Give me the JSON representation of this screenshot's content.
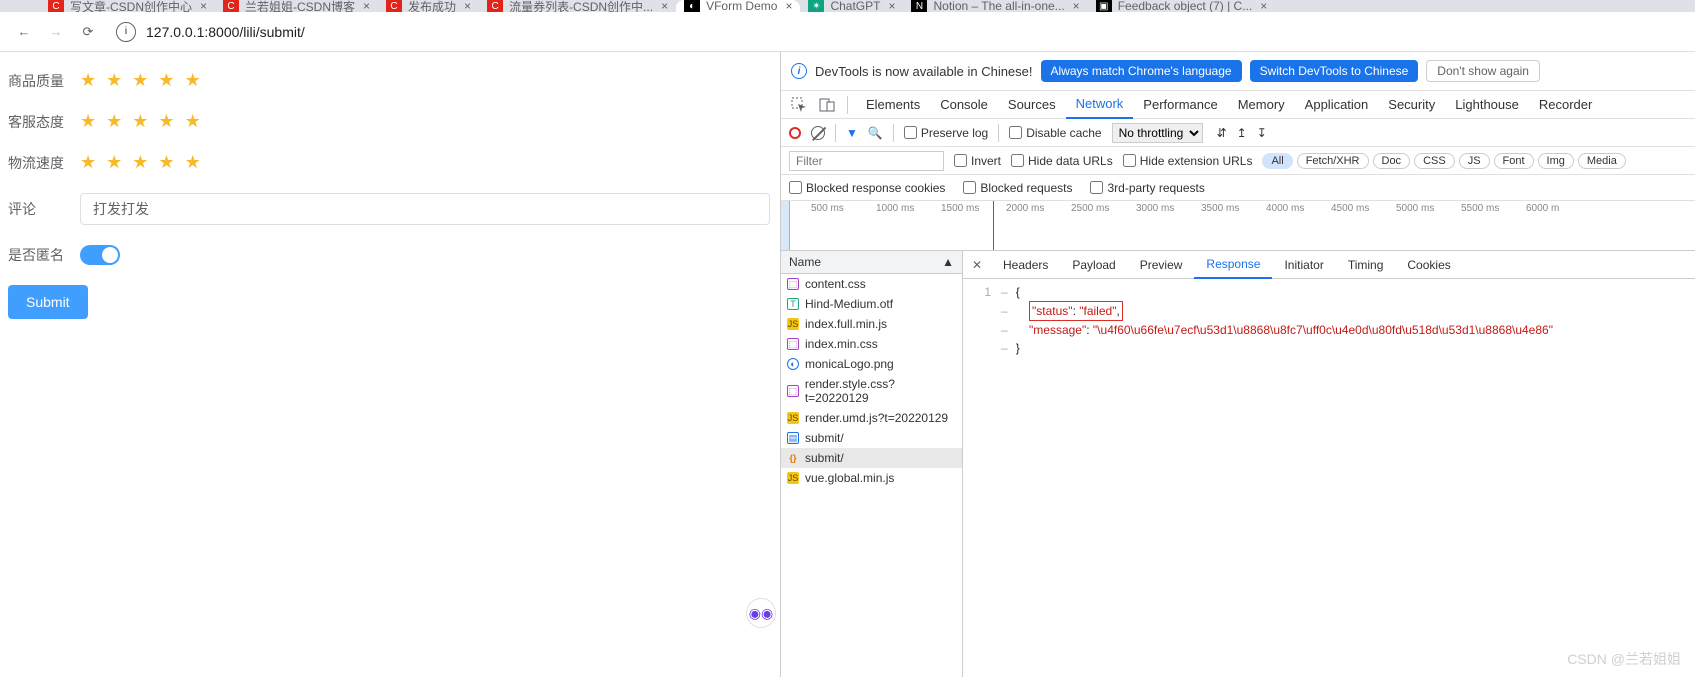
{
  "browser": {
    "tabs": [
      {
        "title": "写文章-CSDN创作中心",
        "fav": "C",
        "favbg": "#e1251b"
      },
      {
        "title": "兰若姐姐-CSDN博客",
        "fav": "C",
        "favbg": "#e1251b"
      },
      {
        "title": "发布成功",
        "fav": "C",
        "favbg": "#e1251b"
      },
      {
        "title": "流量券列表-CSDN创作中...",
        "fav": "C",
        "favbg": "#e1251b"
      },
      {
        "title": "VForm Demo",
        "fav": "◐",
        "favbg": "#000",
        "active": true
      },
      {
        "title": "ChatGPT",
        "fav": "✴",
        "favbg": "#10a37f"
      },
      {
        "title": "Notion – The all-in-one...",
        "fav": "N",
        "favbg": "#000"
      },
      {
        "title": "Feedback object (7) | C...",
        "fav": "▣",
        "favbg": "#000"
      }
    ],
    "url": "127.0.0.1:8000/lili/submit/"
  },
  "form": {
    "rows": [
      {
        "label": "商品质量",
        "type": "stars",
        "value": 5
      },
      {
        "label": "客服态度",
        "type": "stars",
        "value": 5
      },
      {
        "label": "物流速度",
        "type": "stars",
        "value": 5
      },
      {
        "label": "评论",
        "type": "input",
        "value": "打发打发"
      },
      {
        "label": "是否匿名",
        "type": "switch",
        "value": true
      }
    ],
    "submit": "Submit"
  },
  "devtools": {
    "banner": {
      "text": "DevTools is now available in Chinese!",
      "btn1": "Always match Chrome's language",
      "btn2": "Switch DevTools to Chinese",
      "btn3": "Don't show again"
    },
    "tabs": [
      "Elements",
      "Console",
      "Sources",
      "Network",
      "Performance",
      "Memory",
      "Application",
      "Security",
      "Lighthouse",
      "Recorder"
    ],
    "activeTab": "Network",
    "toolbar": {
      "preserve": "Preserve log",
      "disable": "Disable cache",
      "throttle": "No throttling"
    },
    "filter": {
      "placeholder": "Filter",
      "invert": "Invert",
      "hideData": "Hide data URLs",
      "hideExt": "Hide extension URLs",
      "types": [
        "All",
        "Fetch/XHR",
        "Doc",
        "CSS",
        "JS",
        "Font",
        "Img",
        "Media"
      ]
    },
    "filter2": {
      "blockedCookies": "Blocked response cookies",
      "blockedReq": "Blocked requests",
      "thirdParty": "3rd-party requests"
    },
    "timeline": {
      "ticks": [
        "500 ms",
        "1000 ms",
        "1500 ms",
        "2000 ms",
        "2500 ms",
        "3000 ms",
        "3500 ms",
        "4000 ms",
        "4500 ms",
        "5000 ms",
        "5500 ms",
        "6000 m"
      ],
      "marker_ms": 1900
    },
    "requests": {
      "header": "Name",
      "items": [
        {
          "name": "content.css",
          "icon": "css"
        },
        {
          "name": "Hind-Medium.otf",
          "icon": "font"
        },
        {
          "name": "index.full.min.js",
          "icon": "js"
        },
        {
          "name": "index.min.css",
          "icon": "css"
        },
        {
          "name": "monicaLogo.png",
          "icon": "img"
        },
        {
          "name": "render.style.css?t=20220129",
          "icon": "css"
        },
        {
          "name": "render.umd.js?t=20220129",
          "icon": "js"
        },
        {
          "name": "submit/",
          "icon": "doc"
        },
        {
          "name": "submit/",
          "icon": "xhr",
          "selected": true
        },
        {
          "name": "vue.global.min.js",
          "icon": "js"
        }
      ]
    },
    "detail": {
      "tabs": [
        "Headers",
        "Payload",
        "Preview",
        "Response",
        "Initiator",
        "Timing",
        "Cookies"
      ],
      "active": "Response",
      "body": {
        "line1": "{",
        "status_key": "\"status\"",
        "status_val": "\"failed\"",
        "msg_key": "\"message\"",
        "msg_val": "\"\\u4f60\\u66fe\\u7ecf\\u53d1\\u8868\\u8fc7\\uff0c\\u4e0d\\u80fd\\u518d\\u53d1\\u8868\\u4e86\"",
        "line4": "}"
      }
    }
  },
  "watermark": "CSDN @兰若姐姐"
}
